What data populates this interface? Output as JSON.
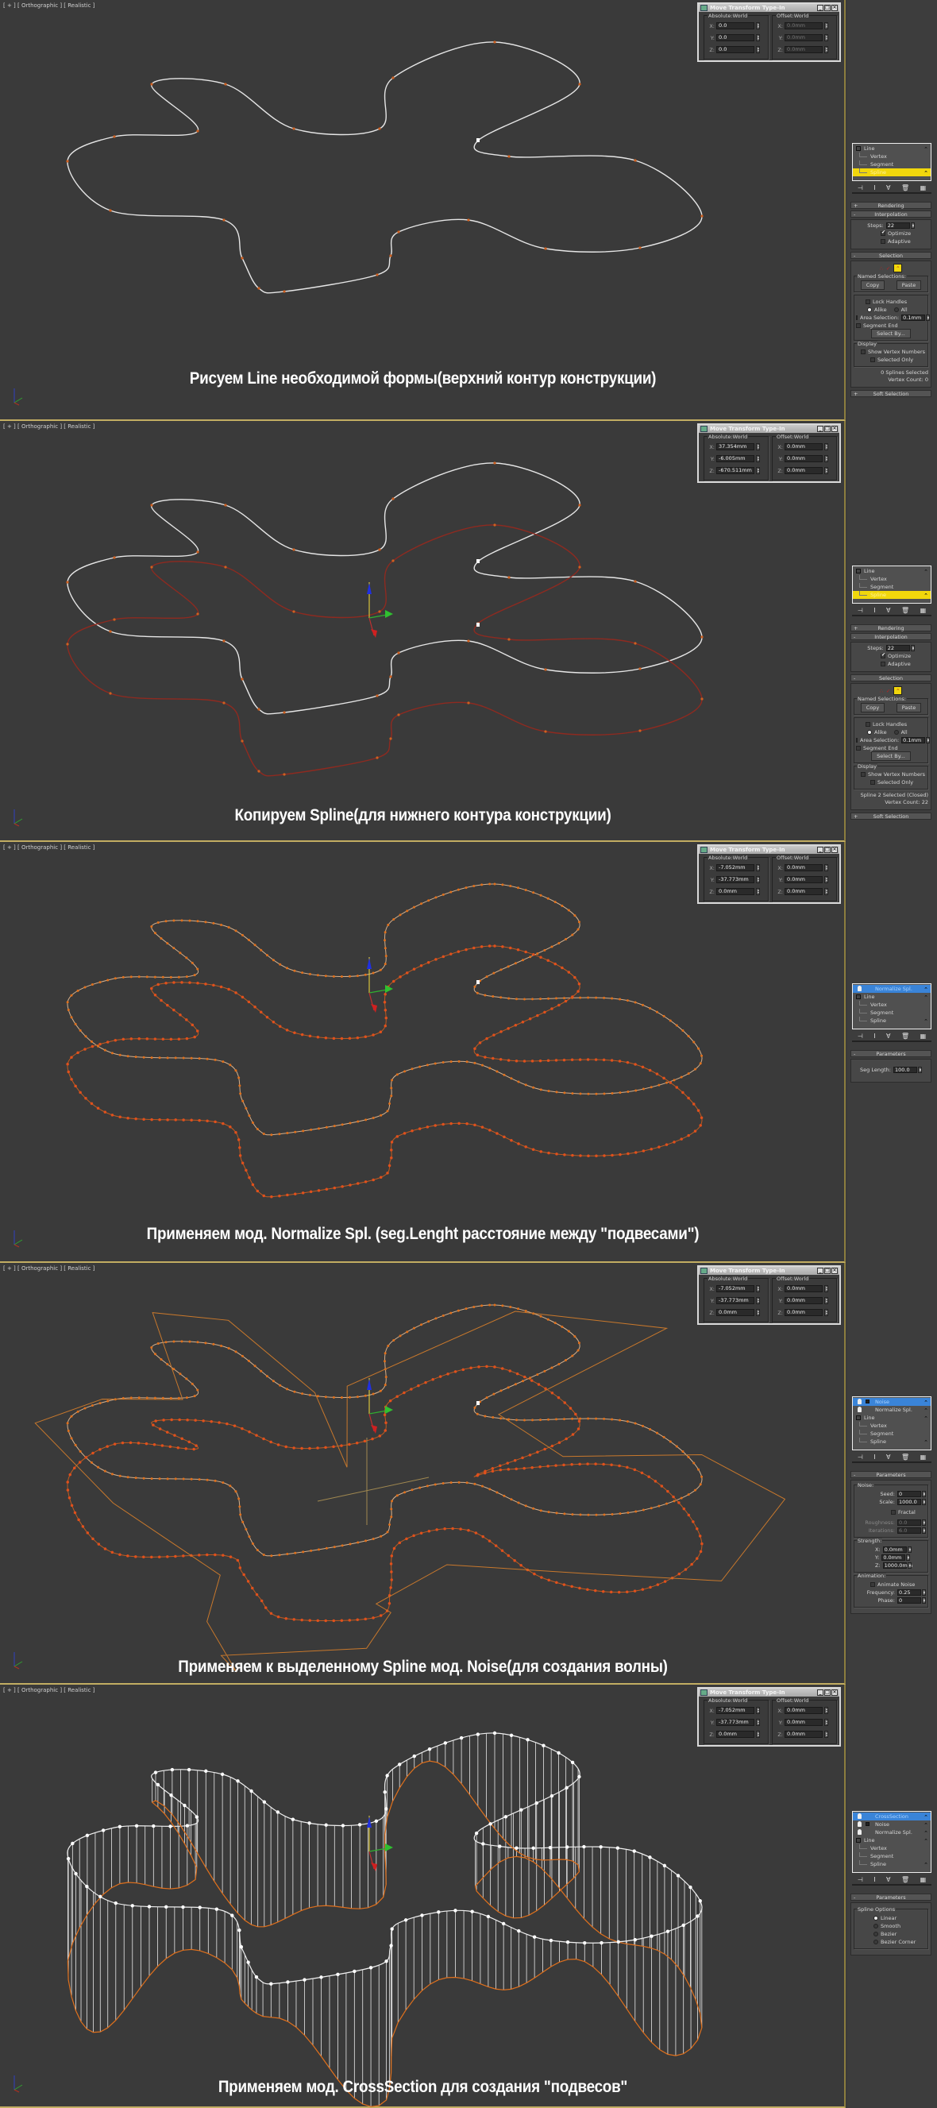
{
  "viewport_label": "[ + ] [ Orthographic ] [ Realistic ]",
  "dialog": {
    "title": "Move Transform Type-In",
    "abs_label": "Absolute:World",
    "off_label": "Offset:World",
    "axes": [
      "X:",
      "Y:",
      "Z:"
    ]
  },
  "stack_toolbar_icons": [
    "pin-stack-icon",
    "show-end-result-icon",
    "make-unique-icon",
    "remove-modifier-icon",
    "configure-modifier-sets-icon"
  ],
  "colors": {
    "selected_modifier": "#3a84d8",
    "active_subobject": "#f1d70c",
    "spline_white": "#e8e8e8",
    "spline_copy_red": "#8e2a20",
    "spline_orange": "#e0701c",
    "viewport_border": "#c2ad62"
  },
  "panels": [
    {
      "caption": "Рисуем Line необходимой формы(верхний контур конструкции)",
      "dialog": {
        "abs": [
          "0.0",
          "0.0",
          "0.0"
        ],
        "off": [
          "0.0mm",
          "0.0mm",
          "0.0mm"
        ],
        "off_dim": true
      },
      "stack": [
        {
          "label": "Line",
          "kind": "base"
        },
        {
          "label": "Vertex",
          "kind": "sub"
        },
        {
          "label": "Segment",
          "kind": "sub"
        },
        {
          "label": "Spline",
          "kind": "sub",
          "active": true
        }
      ],
      "type": "line",
      "right": {
        "rendering": "Rendering",
        "interpolation": "Interpolation",
        "steps_label": "Steps:",
        "steps": "22",
        "optimize": "Optimize",
        "optimize_checked": true,
        "adaptive": "Adaptive",
        "adaptive_checked": false,
        "selection": "Selection",
        "named_sel": "Named Selections:",
        "copy": "Copy",
        "paste": "Paste",
        "lock_handles": "Lock Handles",
        "alike": "Alike",
        "all": "All",
        "area_sel": "Area Selection:",
        "area_val": "0.1mm",
        "segment_end": "Segment End",
        "select_by": "Select By...",
        "display": "Display",
        "show_vnums": "Show Vertex Numbers",
        "selected_only": "Selected Only",
        "status1": "0 Splines Selected",
        "status2": "Vertex Count: 0",
        "soft_sel": "Soft Selection"
      }
    },
    {
      "caption": "Копируем Spline(для нижнего контура конструкции)",
      "dialog": {
        "abs": [
          "37.354mm",
          "-6.005mm",
          "-670.511mm"
        ],
        "off": [
          "0.0mm",
          "0.0mm",
          "0.0mm"
        ],
        "off_dim": false
      },
      "stack": [
        {
          "label": "Line",
          "kind": "base"
        },
        {
          "label": "Vertex",
          "kind": "sub"
        },
        {
          "label": "Segment",
          "kind": "sub"
        },
        {
          "label": "Spline",
          "kind": "sub",
          "active": true
        }
      ],
      "type": "line",
      "right": {
        "rendering": "Rendering",
        "interpolation": "Interpolation",
        "steps_label": "Steps:",
        "steps": "22",
        "optimize": "Optimize",
        "optimize_checked": true,
        "adaptive": "Adaptive",
        "adaptive_checked": false,
        "selection": "Selection",
        "named_sel": "Named Selections:",
        "copy": "Copy",
        "paste": "Paste",
        "lock_handles": "Lock Handles",
        "alike": "Alike",
        "all": "All",
        "area_sel": "Area Selection:",
        "area_val": "0.1mm",
        "segment_end": "Segment End",
        "select_by": "Select By...",
        "display": "Display",
        "show_vnums": "Show Vertex Numbers",
        "selected_only": "Selected Only",
        "status1": "Spline 2 Selected (Closed)",
        "status2": "Vertex Count: 22",
        "soft_sel": "Soft Selection"
      }
    },
    {
      "caption": "Применяем мод. Normalize Spl. (seg.Lenght расстояние между \"подвесами\")",
      "dialog": {
        "abs": [
          "-7.052mm",
          "-37.773mm",
          "0.0mm"
        ],
        "off": [
          "0.0mm",
          "0.0mm",
          "0.0mm"
        ],
        "off_dim": false
      },
      "stack": [
        {
          "label": "Normalize Spl.",
          "kind": "mod",
          "selected": true
        },
        {
          "label": "Line",
          "kind": "base"
        },
        {
          "label": "Vertex",
          "kind": "sub"
        },
        {
          "label": "Segment",
          "kind": "sub"
        },
        {
          "label": "Spline",
          "kind": "sub"
        }
      ],
      "type": "normalize",
      "right": {
        "parameters": "Parameters",
        "seg_length_label": "Seg Length:",
        "seg_length": "100.0"
      }
    },
    {
      "caption": "Применяем к выделенному Spline мод. Noise(для создания волны)",
      "dialog": {
        "abs": [
          "-7.052mm",
          "-37.773mm",
          "0.0mm"
        ],
        "off": [
          "0.0mm",
          "0.0mm",
          "0.0mm"
        ],
        "off_dim": false
      },
      "stack": [
        {
          "label": "Noise",
          "kind": "mod",
          "selected": true,
          "expandable": true
        },
        {
          "label": "Normalize Spl.",
          "kind": "mod"
        },
        {
          "label": "Line",
          "kind": "base"
        },
        {
          "label": "Vertex",
          "kind": "sub"
        },
        {
          "label": "Segment",
          "kind": "sub"
        },
        {
          "label": "Spline",
          "kind": "sub"
        }
      ],
      "type": "noise",
      "right": {
        "parameters": "Parameters",
        "noise": "Noise:",
        "seed_label": "Seed:",
        "seed": "0",
        "scale_label": "Scale:",
        "scale": "1000.0",
        "fractal": "Fractal",
        "fractal_checked": false,
        "roughness_label": "Roughness:",
        "roughness": "0.0",
        "iterations_label": "Iterations:",
        "iterations": "6.0",
        "strength": "Strength:",
        "sx": "0.0mm",
        "sy": "0.0mm",
        "sz": "1000.0mm",
        "animation": "Animation:",
        "animate_noise": "Animate Noise",
        "animate_checked": false,
        "frequency_label": "Frequency:",
        "frequency": "0.25",
        "phase_label": "Phase:",
        "phase": "0"
      }
    },
    {
      "caption": "Применяем мод. CrossSection для создания \"подвесов\"",
      "dialog": {
        "abs": [
          "-7.052mm",
          "-37.773mm",
          "0.0mm"
        ],
        "off": [
          "0.0mm",
          "0.0mm",
          "0.0mm"
        ],
        "off_dim": false
      },
      "stack": [
        {
          "label": "CrossSection",
          "kind": "mod",
          "selected": true
        },
        {
          "label": "Noise",
          "kind": "mod",
          "expandable": true
        },
        {
          "label": "Normalize Spl.",
          "kind": "mod"
        },
        {
          "label": "Line",
          "kind": "base"
        },
        {
          "label": "Vertex",
          "kind": "sub"
        },
        {
          "label": "Segment",
          "kind": "sub"
        },
        {
          "label": "Spline",
          "kind": "sub"
        }
      ],
      "type": "crosssection",
      "right": {
        "parameters": "Parameters",
        "spline_options": "Spline Options",
        "options": [
          "Linear",
          "Smooth",
          "Bezier",
          "Bezier Corner"
        ],
        "selected_option": "Linear"
      }
    }
  ]
}
